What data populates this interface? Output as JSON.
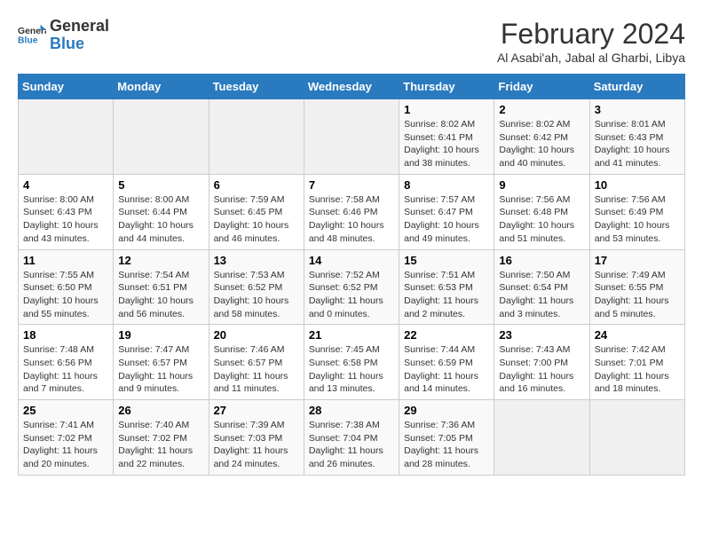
{
  "header": {
    "logo_line1": "General",
    "logo_line2": "Blue",
    "title": "February 2024",
    "subtitle": "Al Asabi'ah, Jabal al Gharbi, Libya"
  },
  "weekdays": [
    "Sunday",
    "Monday",
    "Tuesday",
    "Wednesday",
    "Thursday",
    "Friday",
    "Saturday"
  ],
  "weeks": [
    [
      {
        "day": "",
        "info": ""
      },
      {
        "day": "",
        "info": ""
      },
      {
        "day": "",
        "info": ""
      },
      {
        "day": "",
        "info": ""
      },
      {
        "day": "1",
        "info": "Sunrise: 8:02 AM\nSunset: 6:41 PM\nDaylight: 10 hours and 38 minutes."
      },
      {
        "day": "2",
        "info": "Sunrise: 8:02 AM\nSunset: 6:42 PM\nDaylight: 10 hours and 40 minutes."
      },
      {
        "day": "3",
        "info": "Sunrise: 8:01 AM\nSunset: 6:43 PM\nDaylight: 10 hours and 41 minutes."
      }
    ],
    [
      {
        "day": "4",
        "info": "Sunrise: 8:00 AM\nSunset: 6:43 PM\nDaylight: 10 hours and 43 minutes."
      },
      {
        "day": "5",
        "info": "Sunrise: 8:00 AM\nSunset: 6:44 PM\nDaylight: 10 hours and 44 minutes."
      },
      {
        "day": "6",
        "info": "Sunrise: 7:59 AM\nSunset: 6:45 PM\nDaylight: 10 hours and 46 minutes."
      },
      {
        "day": "7",
        "info": "Sunrise: 7:58 AM\nSunset: 6:46 PM\nDaylight: 10 hours and 48 minutes."
      },
      {
        "day": "8",
        "info": "Sunrise: 7:57 AM\nSunset: 6:47 PM\nDaylight: 10 hours and 49 minutes."
      },
      {
        "day": "9",
        "info": "Sunrise: 7:56 AM\nSunset: 6:48 PM\nDaylight: 10 hours and 51 minutes."
      },
      {
        "day": "10",
        "info": "Sunrise: 7:56 AM\nSunset: 6:49 PM\nDaylight: 10 hours and 53 minutes."
      }
    ],
    [
      {
        "day": "11",
        "info": "Sunrise: 7:55 AM\nSunset: 6:50 PM\nDaylight: 10 hours and 55 minutes."
      },
      {
        "day": "12",
        "info": "Sunrise: 7:54 AM\nSunset: 6:51 PM\nDaylight: 10 hours and 56 minutes."
      },
      {
        "day": "13",
        "info": "Sunrise: 7:53 AM\nSunset: 6:52 PM\nDaylight: 10 hours and 58 minutes."
      },
      {
        "day": "14",
        "info": "Sunrise: 7:52 AM\nSunset: 6:52 PM\nDaylight: 11 hours and 0 minutes."
      },
      {
        "day": "15",
        "info": "Sunrise: 7:51 AM\nSunset: 6:53 PM\nDaylight: 11 hours and 2 minutes."
      },
      {
        "day": "16",
        "info": "Sunrise: 7:50 AM\nSunset: 6:54 PM\nDaylight: 11 hours and 3 minutes."
      },
      {
        "day": "17",
        "info": "Sunrise: 7:49 AM\nSunset: 6:55 PM\nDaylight: 11 hours and 5 minutes."
      }
    ],
    [
      {
        "day": "18",
        "info": "Sunrise: 7:48 AM\nSunset: 6:56 PM\nDaylight: 11 hours and 7 minutes."
      },
      {
        "day": "19",
        "info": "Sunrise: 7:47 AM\nSunset: 6:57 PM\nDaylight: 11 hours and 9 minutes."
      },
      {
        "day": "20",
        "info": "Sunrise: 7:46 AM\nSunset: 6:57 PM\nDaylight: 11 hours and 11 minutes."
      },
      {
        "day": "21",
        "info": "Sunrise: 7:45 AM\nSunset: 6:58 PM\nDaylight: 11 hours and 13 minutes."
      },
      {
        "day": "22",
        "info": "Sunrise: 7:44 AM\nSunset: 6:59 PM\nDaylight: 11 hours and 14 minutes."
      },
      {
        "day": "23",
        "info": "Sunrise: 7:43 AM\nSunset: 7:00 PM\nDaylight: 11 hours and 16 minutes."
      },
      {
        "day": "24",
        "info": "Sunrise: 7:42 AM\nSunset: 7:01 PM\nDaylight: 11 hours and 18 minutes."
      }
    ],
    [
      {
        "day": "25",
        "info": "Sunrise: 7:41 AM\nSunset: 7:02 PM\nDaylight: 11 hours and 20 minutes."
      },
      {
        "day": "26",
        "info": "Sunrise: 7:40 AM\nSunset: 7:02 PM\nDaylight: 11 hours and 22 minutes."
      },
      {
        "day": "27",
        "info": "Sunrise: 7:39 AM\nSunset: 7:03 PM\nDaylight: 11 hours and 24 minutes."
      },
      {
        "day": "28",
        "info": "Sunrise: 7:38 AM\nSunset: 7:04 PM\nDaylight: 11 hours and 26 minutes."
      },
      {
        "day": "29",
        "info": "Sunrise: 7:36 AM\nSunset: 7:05 PM\nDaylight: 11 hours and 28 minutes."
      },
      {
        "day": "",
        "info": ""
      },
      {
        "day": "",
        "info": ""
      }
    ]
  ]
}
